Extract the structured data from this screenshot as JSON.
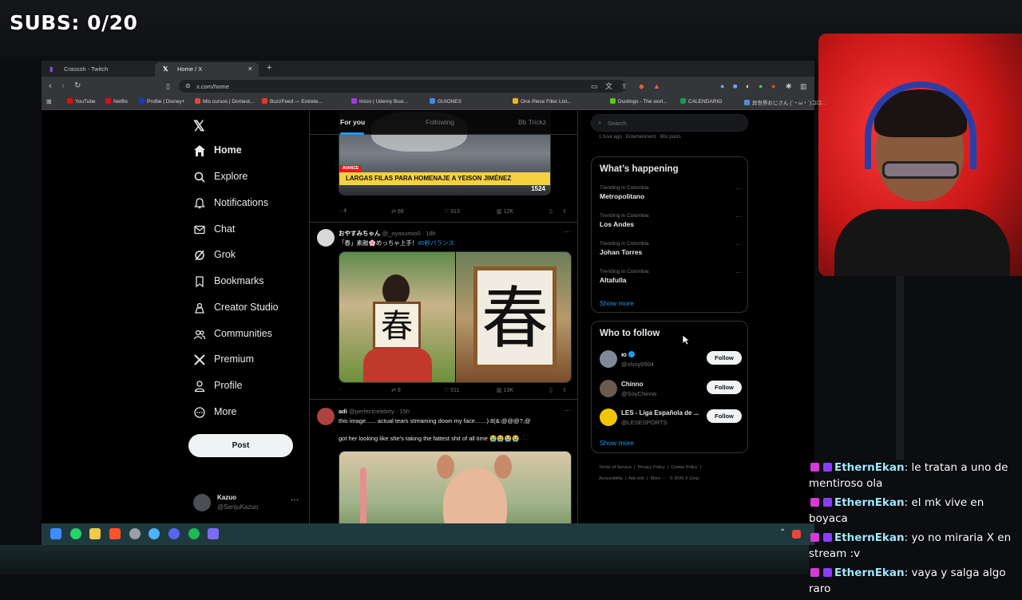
{
  "overlay": {
    "subs": "SUBS: 0/20"
  },
  "browser": {
    "tabs": [
      {
        "label": "Crasssh - Twitch",
        "icon": "twitch-icon"
      },
      {
        "label": "Home / X",
        "icon": "x-icon"
      }
    ],
    "url": "x.com/home",
    "bookmarks": [
      "YouTube",
      "Netflix",
      "Profile | Disney+",
      "Mis cursos | Domest...",
      "BuzzFeed — Entrete...",
      "Inicio | Udemy Busi...",
      "GUIONES",
      "One Piece Filler List...",
      "Duolingo - The worl...",
      "CALENDARIO",
      "异世界おじさん (´・ω・`)コロ..."
    ]
  },
  "x": {
    "nav": [
      {
        "label": "Home",
        "icon": "home-icon",
        "active": true
      },
      {
        "label": "Explore",
        "icon": "search-icon"
      },
      {
        "label": "Notifications",
        "icon": "bell-icon"
      },
      {
        "label": "Chat",
        "icon": "mail-icon"
      },
      {
        "label": "Grok",
        "icon": "grok-icon"
      },
      {
        "label": "Bookmarks",
        "icon": "bookmark-icon"
      },
      {
        "label": "Creator Studio",
        "icon": "creator-studio-icon"
      },
      {
        "label": "Communities",
        "icon": "communities-icon"
      },
      {
        "label": "Premium",
        "icon": "x-premium-icon"
      },
      {
        "label": "Profile",
        "icon": "profile-icon"
      },
      {
        "label": "More",
        "icon": "more-circle-icon"
      }
    ],
    "post_button": "Post",
    "account": {
      "name": "Kazuo",
      "handle": "@SenjuKazuo"
    },
    "feed_tabs": [
      "For you",
      "Following",
      "Bb Trickz"
    ],
    "posts": [
      {
        "image_caption": "LARGAS FILAS PARA HOMENAJE A YEISON JIMÉNEZ",
        "image_tag": "AVANCE",
        "image_number": "1524",
        "replies": "4",
        "reposts": "68",
        "likes": "913",
        "views": "12K"
      },
      {
        "author": "おやすみちゃん",
        "handle": "@_oyasumio0",
        "time": "18h",
        "text": "「春」素敵🌸めっちゃ上手！",
        "hashtag": "#0秒バランス",
        "image_kanji": "春",
        "replies": "",
        "reposts": "9",
        "likes": "511",
        "views": "13K"
      },
      {
        "author": "adi",
        "handle": "@perfectcelebrty",
        "time": "15h",
        "text1": "this image...... actual tears streaming down my face.......):8(&:@@@?,@",
        "text2": "got her looking like she's taking the fattest shit of all time 😭😭😭😭"
      }
    ],
    "search_placeholder": "Search",
    "top_snippet": "1 hour ago · Entertainment · 80o posts",
    "whats_happening": {
      "title": "What’s happening",
      "trends": [
        {
          "context": "Trending in Colombia",
          "name": "Metropolitano"
        },
        {
          "context": "Trending in Colombia",
          "name": "Los Andes"
        },
        {
          "context": "Trending in Colombia",
          "name": "Johan Torres"
        },
        {
          "context": "Trending in Colombia",
          "name": "Altafulla"
        }
      ],
      "show_more": "Show more"
    },
    "who_to_follow": {
      "title": "Who to follow",
      "users": [
        {
          "name": "ю",
          "handle": "@xlvsy0504",
          "button": "Follow",
          "verified": true
        },
        {
          "name": "Chinno",
          "handle": "@SoyChinno",
          "button": "Follow"
        },
        {
          "name": "LES - Liga Española de ...",
          "handle": "@LESESPORTS",
          "button": "Follow"
        }
      ],
      "show_more": "Show more"
    },
    "footer": [
      "Terms of Service",
      "Privacy Policy",
      "Cookie Policy",
      "Accessibility",
      "Ads info",
      "More ···",
      "© 2026 X Corp."
    ]
  },
  "chat": [
    {
      "user": "EthernEkan",
      "text": "le tratan a uno de mentiroso ola"
    },
    {
      "user": "EthernEkan",
      "text": "el mk vive en boyaca"
    },
    {
      "user": "EthernEkan",
      "text": "yo no miraria X en stream :v"
    },
    {
      "user": "EthernEkan",
      "text": "vaya y salga algo raro"
    }
  ],
  "colors": {
    "accent": "#1d9bf0",
    "background": "#000000",
    "chat_user": "#9fe8ff",
    "webcam_bg": "#e02020"
  }
}
